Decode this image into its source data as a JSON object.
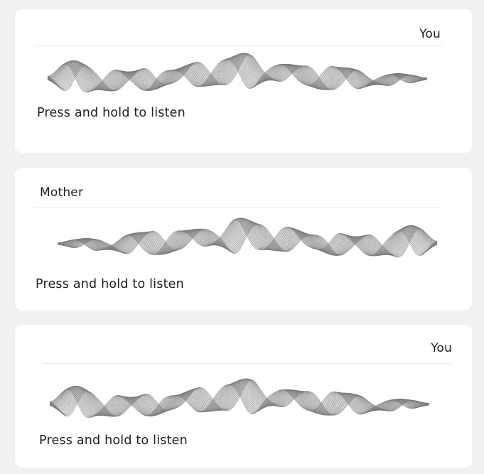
{
  "messages": [
    {
      "speaker": "You",
      "hint": "Press and hold to listen",
      "align": "right"
    },
    {
      "speaker": "Mother",
      "hint": "Press and hold to listen",
      "align": "left"
    },
    {
      "speaker": "You",
      "hint": "Press and hold to listen",
      "align": "right"
    }
  ],
  "colors": {
    "background": "#f1f1f1",
    "card": "#ffffff",
    "wave": "#7a7a7a",
    "text": "#1e1e1e"
  }
}
